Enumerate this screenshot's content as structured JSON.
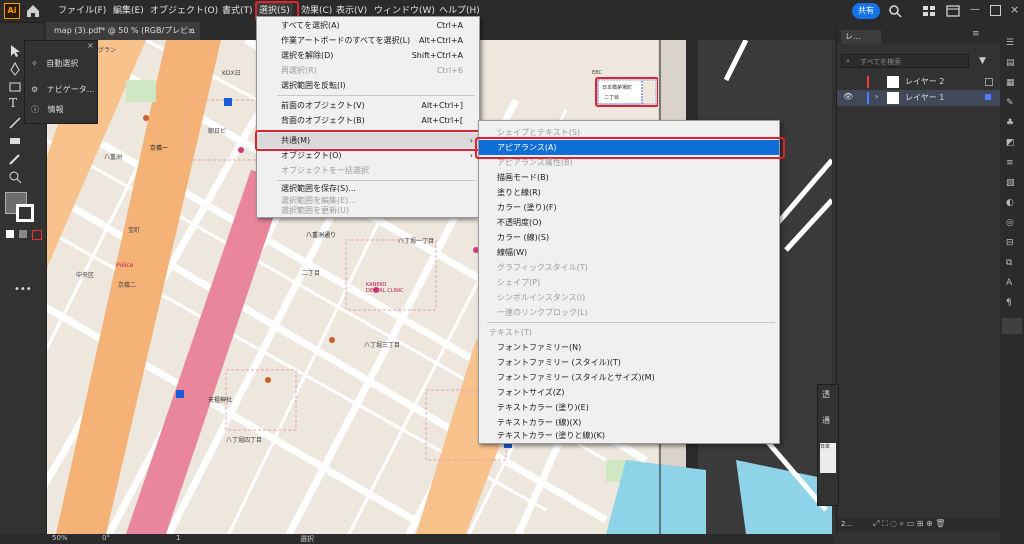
{
  "app": {
    "logo": "Ai",
    "share_label": "共有",
    "icons": [
      "home-icon",
      "search-icon",
      "workspace-icon",
      "panels-icon"
    ]
  },
  "menubar": {
    "items": [
      "ファイル(F)",
      "編集(E)",
      "オブジェクト(O)",
      "書式(T)",
      "選択(S)",
      "効果(C)",
      "表示(V)",
      "ウィンドウ(W)",
      "ヘルプ(H)"
    ],
    "active_index": 4
  },
  "document_tab": {
    "title": "map (3).pdf* @ 50 % (RGB/プレビュー)",
    "close": "×"
  },
  "float_panel": {
    "items": [
      "自動選択",
      "ナビゲータ...",
      "情報"
    ]
  },
  "select_menu": {
    "items": [
      {
        "label": "すべてを選択(A)",
        "shortcut": "Ctrl+A",
        "disabled": false
      },
      {
        "label": "作業アートボードのすべてを選択(L)",
        "shortcut": "Alt+Ctrl+A",
        "disabled": false
      },
      {
        "label": "選択を解除(D)",
        "shortcut": "Shift+Ctrl+A",
        "disabled": false
      },
      {
        "label": "再選択(R)",
        "shortcut": "Ctrl+6",
        "disabled": true
      },
      {
        "label": "選択範囲を反転(I)",
        "shortcut": "",
        "disabled": false
      },
      {
        "label": "前面のオブジェクト(V)",
        "shortcut": "Alt+Ctrl+]",
        "disabled": false
      },
      {
        "label": "背面のオブジェクト(B)",
        "shortcut": "Alt+Ctrl+[",
        "disabled": false
      },
      {
        "label": "共通(M)",
        "shortcut": "",
        "disabled": false,
        "submenu": true
      },
      {
        "label": "オブジェクト(O)",
        "shortcut": "",
        "disabled": false,
        "submenu": true
      },
      {
        "label": "オブジェクトを一括選択",
        "shortcut": "",
        "disabled": true
      },
      {
        "label": "選択範囲を保存(S)...",
        "shortcut": "",
        "disabled": false
      },
      {
        "label": "選択範囲を編集(E)...",
        "shortcut": "",
        "disabled": true
      },
      {
        "label": "選択範囲を更新(U)",
        "shortcut": "",
        "disabled": true
      }
    ]
  },
  "common_submenu": {
    "items": [
      {
        "label": "シェイプとテキスト(S)",
        "disabled": true
      },
      {
        "label": "アピアランス(A)",
        "disabled": false,
        "selected": true
      },
      {
        "label": "アピアランス属性(B)",
        "disabled": true
      },
      {
        "label": "描画モード(B)",
        "disabled": false
      },
      {
        "label": "塗りと線(R)",
        "disabled": false
      },
      {
        "label": "カラー (塗り)(F)",
        "disabled": false
      },
      {
        "label": "不透明度(O)",
        "disabled": false
      },
      {
        "label": "カラー (線)(S)",
        "disabled": false
      },
      {
        "label": "線幅(W)",
        "disabled": false
      },
      {
        "label": "グラフィックスタイル(T)",
        "disabled": true
      },
      {
        "label": "シェイプ(P)",
        "disabled": true
      },
      {
        "label": "シンボルインスタンス(I)",
        "disabled": true
      },
      {
        "label": "一連のリンクブロック(L)",
        "disabled": true
      },
      {
        "label": "テキスト(T)",
        "disabled": true
      },
      {
        "label": "フォントファミリー(N)",
        "disabled": false
      },
      {
        "label": "フォントファミリー (スタイル)(T)",
        "disabled": false
      },
      {
        "label": "フォントファミリー (スタイルとサイズ)(M)",
        "disabled": false
      },
      {
        "label": "フォントサイズ(Z)",
        "disabled": false
      },
      {
        "label": "テキストカラー (塗り)(E)",
        "disabled": false
      },
      {
        "label": "テキストカラー (線)(X)",
        "disabled": false
      },
      {
        "label": "テキストカラー (塗りと線)(K)",
        "disabled": false
      }
    ]
  },
  "layers_panel": {
    "tab_label": "レ...",
    "search_placeholder": "すべてを検索",
    "layers": [
      {
        "name": "レイヤー 2",
        "color": "#ff3b3b",
        "visible": false,
        "selected": false
      },
      {
        "name": "レイヤー 1",
        "color": "#4a7dff",
        "visible": true,
        "selected": true
      }
    ],
    "count_label": "2..."
  },
  "transparency_panel": {
    "tab_label": "透",
    "content_label": "通",
    "field_label": "日本"
  },
  "map_labels": {
    "l1": "グラン",
    "l2": "KDX日",
    "l3": "朝日ビ",
    "l4": "八重洲",
    "l5": "京橋一",
    "l6": "宝町",
    "l7": "八重洲通り",
    "l8": "八丁堀一丁目",
    "l9": "KANEKO DENTAL CLINIC",
    "l10": "八丁堀三丁目",
    "l11": "天祖神社",
    "l12": "八丁堀四丁目",
    "l13": "中央区",
    "l14": "京橋二",
    "l15": "二丁目",
    "l16": "EBC",
    "l17": "日本橋茅場町",
    "l18": "二丁目",
    "l19": "Police"
  },
  "status": {
    "zoom": "50%",
    "rotate": "0°",
    "artboard": "1",
    "tool": "選択"
  }
}
